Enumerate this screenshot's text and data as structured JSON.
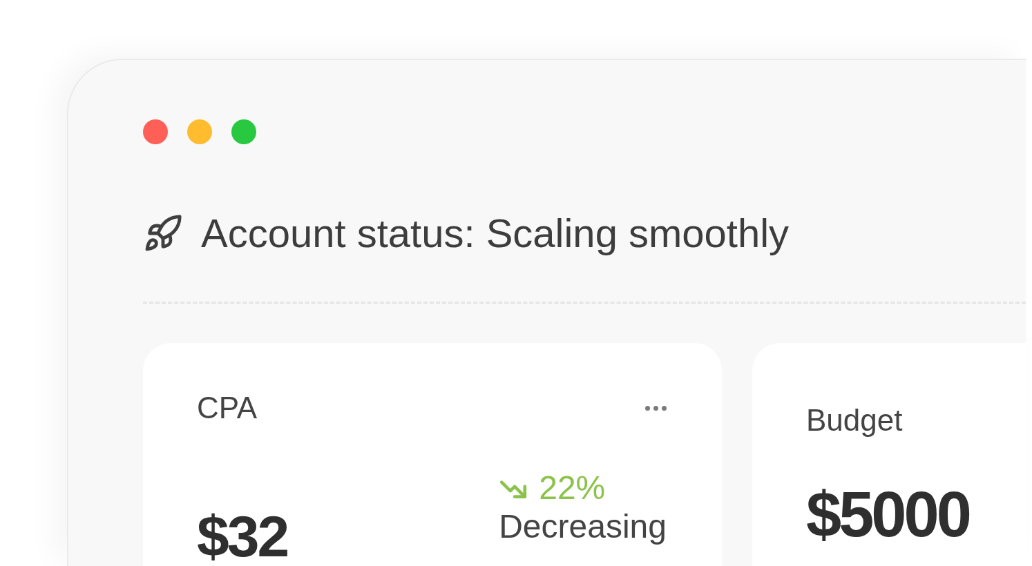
{
  "window": {
    "controls": [
      {
        "color": "#fe5f57"
      },
      {
        "color": "#febc2e"
      },
      {
        "color": "#28c840"
      }
    ]
  },
  "status": {
    "title": "Account status: Scaling smoothly"
  },
  "cards": [
    {
      "kind": "trend",
      "label": "CPA",
      "value": "$32",
      "trend": {
        "change": "22%",
        "text": "Decreasing"
      }
    },
    {
      "kind": "plain",
      "label": "Budget",
      "value": "$5000"
    }
  ]
}
